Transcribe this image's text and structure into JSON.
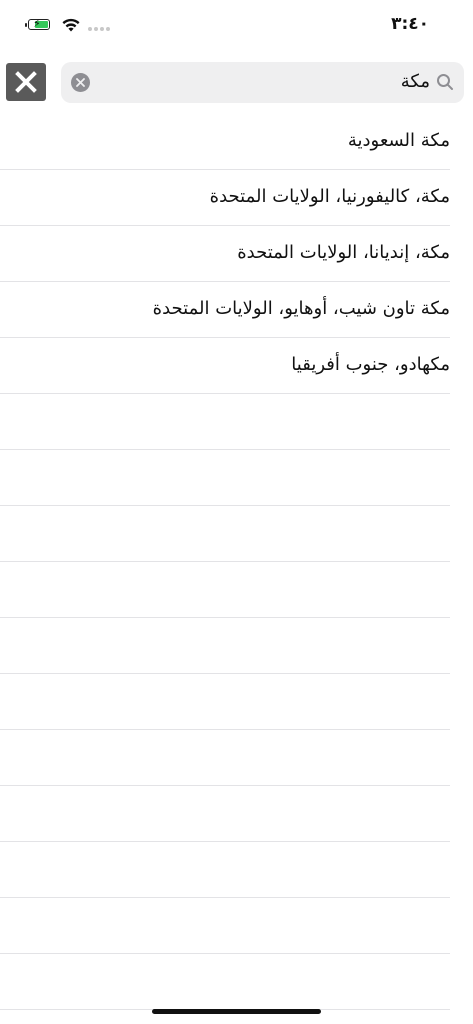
{
  "status_bar": {
    "time": "٣:٤٠",
    "battery_color": "#35c759"
  },
  "search": {
    "query": "مكة",
    "search_icon": "search-icon",
    "clear_icon": "clear-icon"
  },
  "close_button": {
    "icon": "close-icon",
    "background": "#5a5a5a"
  },
  "results": [
    {
      "label": "مكة السعودية"
    },
    {
      "label": "مكة، كاليفورنيا، الولايات المتحدة"
    },
    {
      "label": "مكة، إنديانا، الولايات المتحدة"
    },
    {
      "label": "مكة تاون شيب، أوهايو، الولايات المتحدة"
    },
    {
      "label": "مكهادو، جنوب أفريقيا"
    }
  ]
}
